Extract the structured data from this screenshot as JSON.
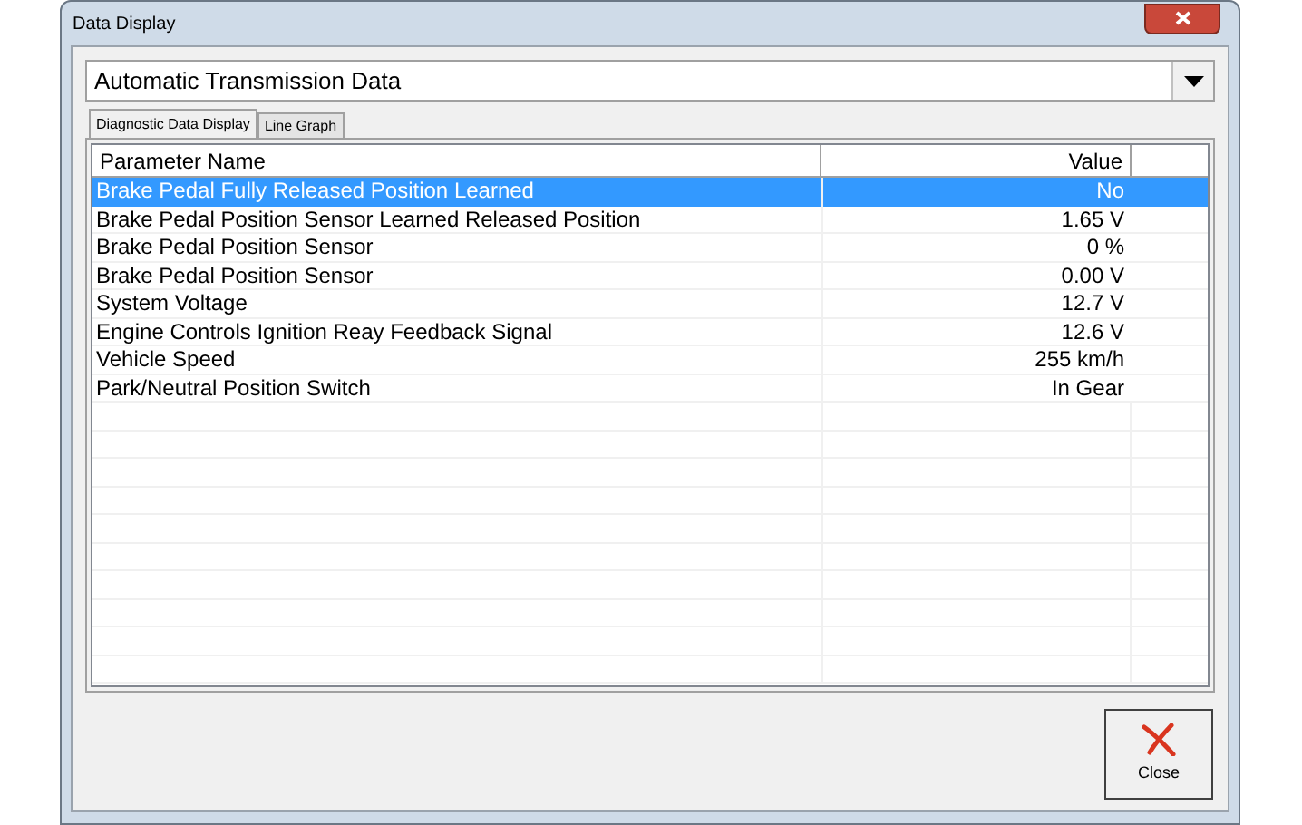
{
  "window": {
    "title": "Data Display"
  },
  "dropdown": {
    "value": "Automatic Transmission Data"
  },
  "tabs": [
    {
      "label": "Diagnostic Data Display",
      "selected": true
    },
    {
      "label": "Line Graph",
      "selected": false
    }
  ],
  "table": {
    "columns": [
      "Parameter Name",
      "Value"
    ],
    "rows": [
      {
        "name": "Brake Pedal Fully Released Position Learned",
        "value": "No",
        "selected": true
      },
      {
        "name": "Brake Pedal Position Sensor Learned Released Position",
        "value": "1.65 V",
        "selected": false
      },
      {
        "name": "Brake Pedal Position Sensor",
        "value": "0 %",
        "selected": false
      },
      {
        "name": "Brake Pedal Position Sensor",
        "value": "0.00 V",
        "selected": false
      },
      {
        "name": "System Voltage",
        "value": "12.7 V",
        "selected": false
      },
      {
        "name": "Engine Controls Ignition Reay Feedback Signal",
        "value": "12.6 V",
        "selected": false
      },
      {
        "name": "Vehicle Speed",
        "value": "255 km/h",
        "selected": false
      },
      {
        "name": "Park/Neutral Position Switch",
        "value": "In Gear",
        "selected": false
      }
    ]
  },
  "close_button": {
    "label": "Close"
  }
}
